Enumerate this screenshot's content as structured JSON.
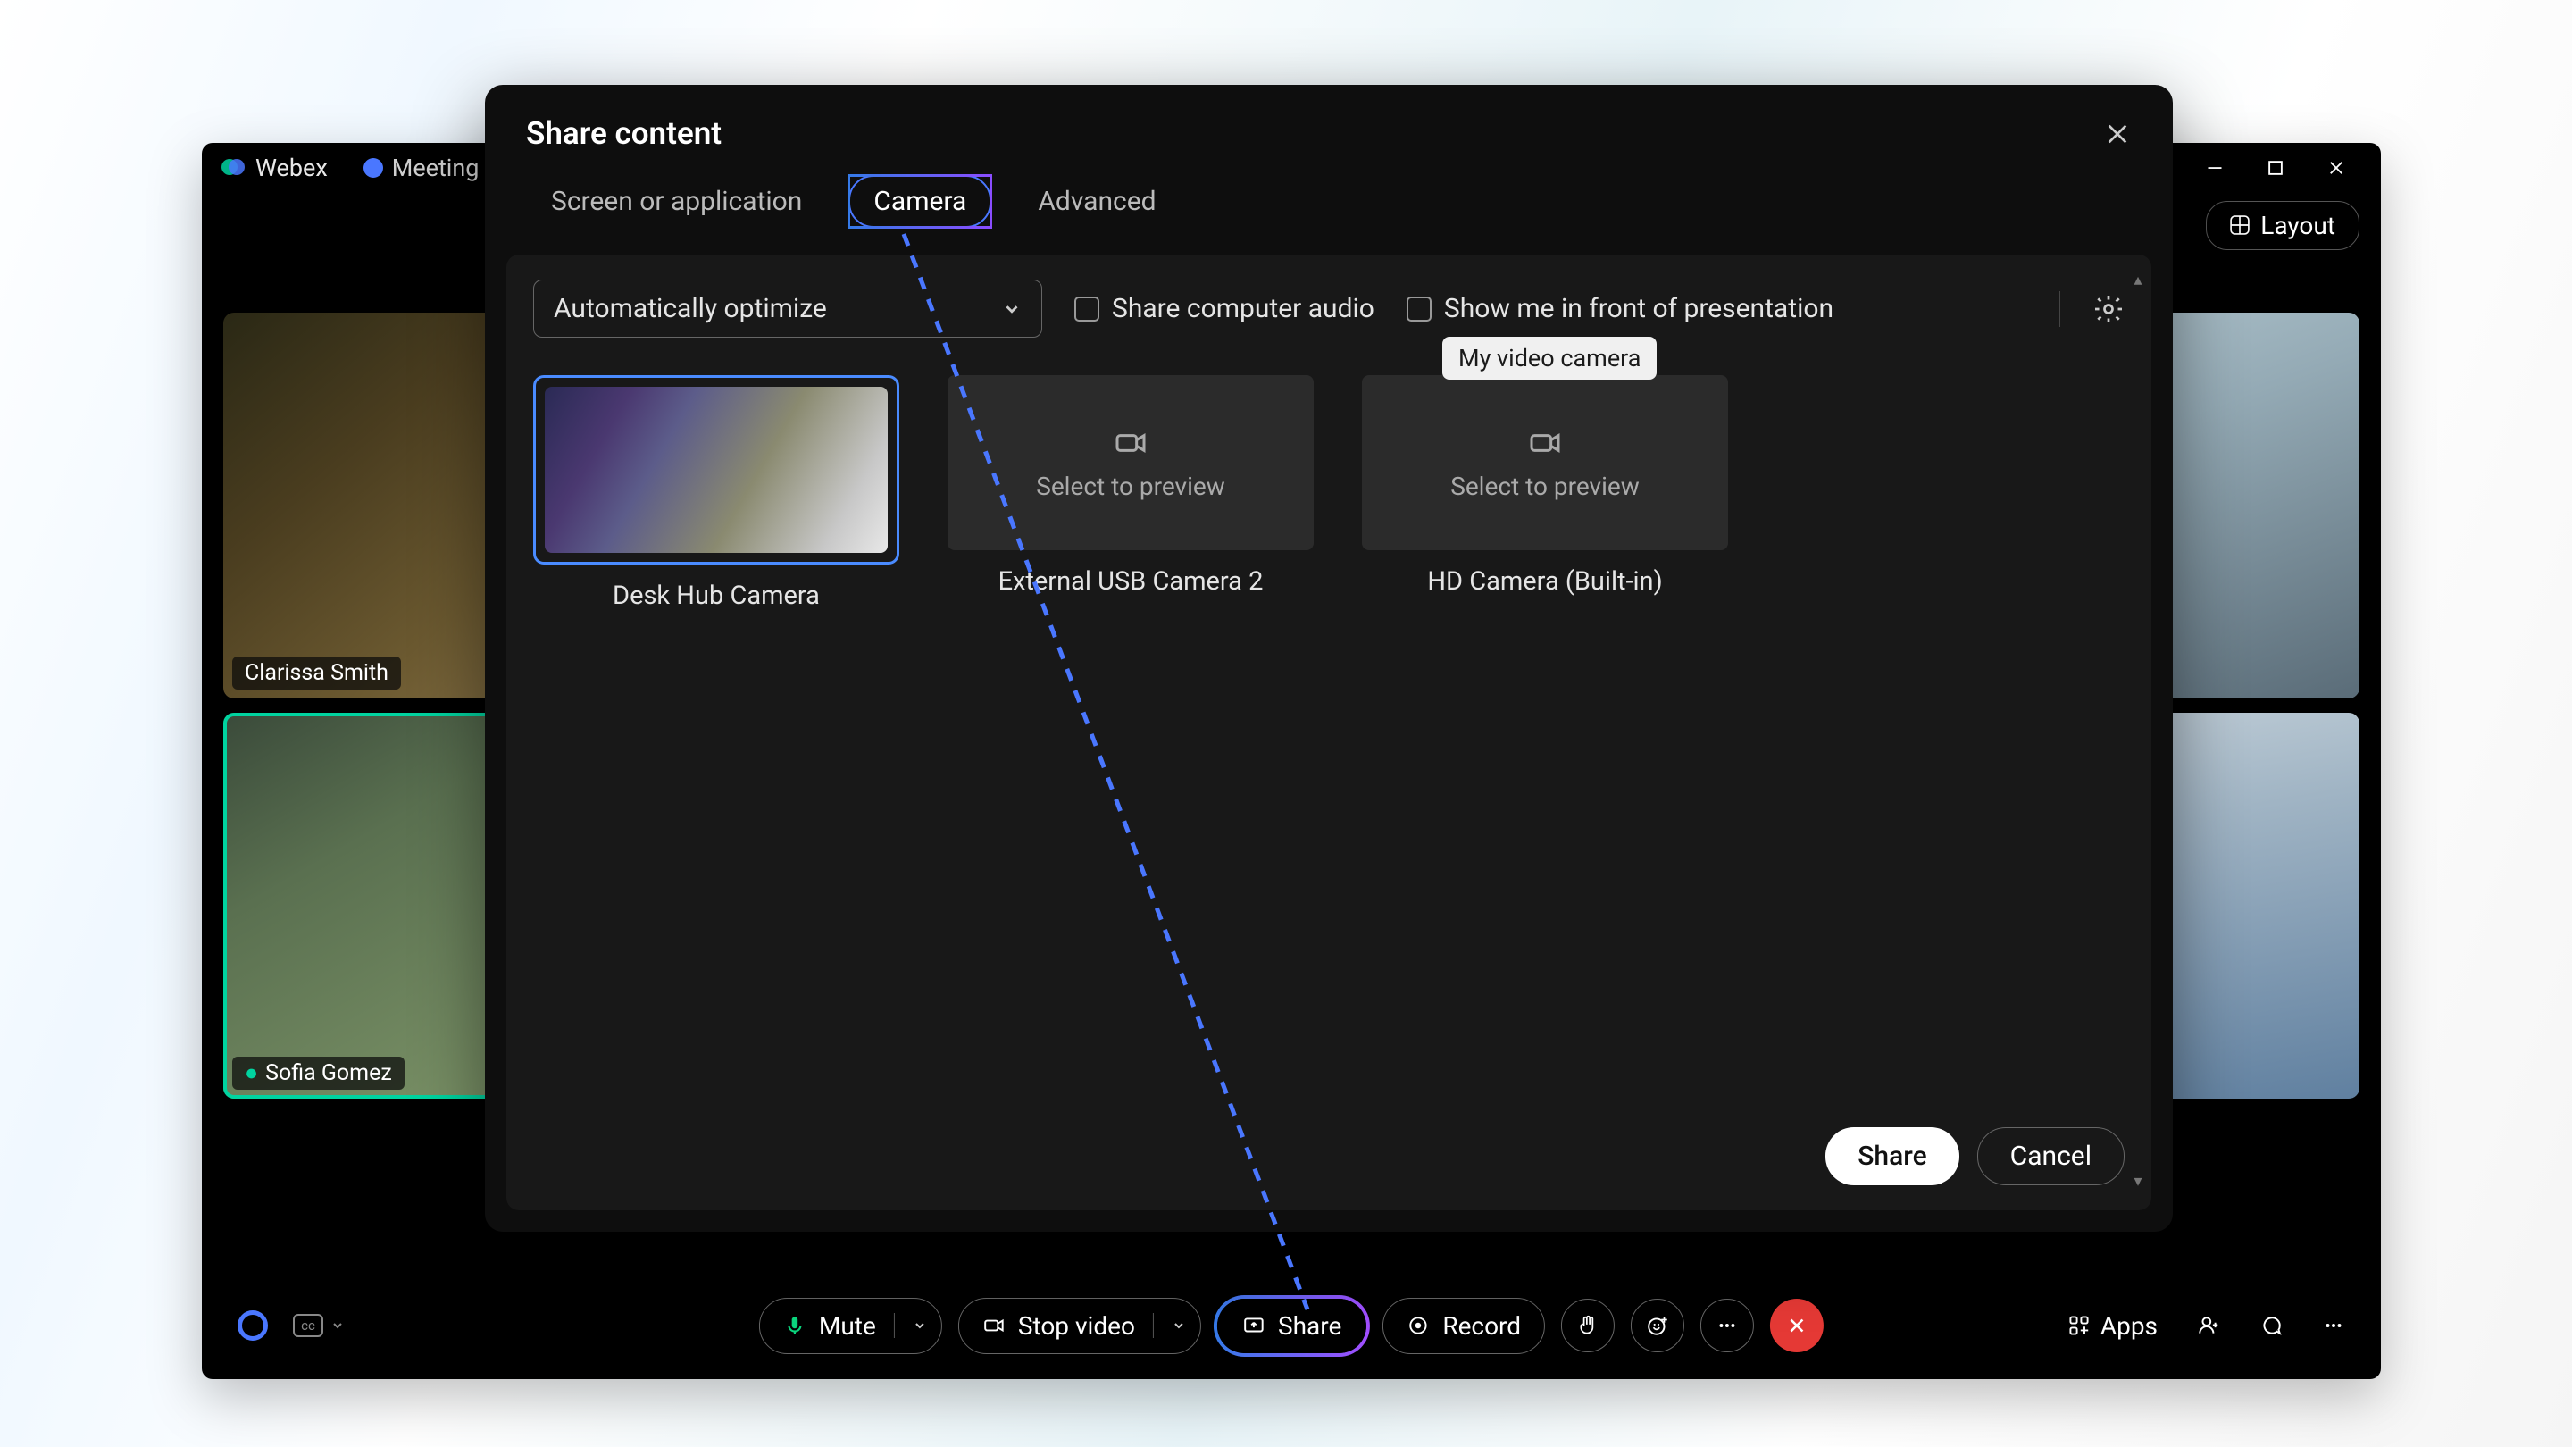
{
  "meeting": {
    "app_name": "Webex",
    "meeting_info_label": "Meeting i",
    "layout_button": "Layout",
    "participants": {
      "p1": "Clarissa Smith",
      "p5": "Sofia Gomez"
    },
    "controls": {
      "mute": "Mute",
      "stop_video": "Stop video",
      "share": "Share",
      "record": "Record",
      "apps": "Apps"
    }
  },
  "share_modal": {
    "title": "Share content",
    "tabs": {
      "screen": "Screen or application",
      "camera": "Camera",
      "advanced": "Advanced"
    },
    "optimize_select": "Automatically optimize",
    "share_audio_label": "Share computer audio",
    "show_me_label": "Show me in front of presentation",
    "tooltip": "My video camera",
    "select_preview": "Select to preview",
    "cameras": {
      "c1": "Desk Hub Camera",
      "c2": "External USB Camera 2",
      "c3": "HD Camera (Built-in)"
    },
    "footer": {
      "share": "Share",
      "cancel": "Cancel"
    }
  }
}
